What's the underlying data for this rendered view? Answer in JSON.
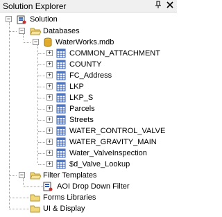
{
  "window": {
    "title": "Solution Explorer",
    "pin_glyph": "p",
    "close_glyph": "×"
  },
  "tree": {
    "solution": {
      "label": "Solution",
      "icon": "solution-icon",
      "expanded": true
    },
    "databases": {
      "label": "Databases",
      "icon": "folder-open-icon",
      "expanded": true
    },
    "database": {
      "label": "WaterWorks.mdb",
      "icon": "database-icon",
      "expanded": true
    },
    "tables": [
      {
        "label": "COMMON_ATTACHMENT",
        "icon": "table-icon"
      },
      {
        "label": "COUNTY",
        "icon": "table-icon"
      },
      {
        "label": "FC_Address",
        "icon": "table-icon"
      },
      {
        "label": "LKP",
        "icon": "table-icon"
      },
      {
        "label": "LKP_S",
        "icon": "table-icon"
      },
      {
        "label": "Parcels",
        "icon": "table-icon"
      },
      {
        "label": "Streets",
        "icon": "table-icon"
      },
      {
        "label": "WATER_CONTROL_VALVE",
        "icon": "table-icon"
      },
      {
        "label": "WATER_GRAVITY_MAIN",
        "icon": "table-icon"
      },
      {
        "label": "Water_ValveInspection",
        "icon": "table-icon"
      },
      {
        "label": "$d_Valve_Lookup",
        "icon": "table-icon"
      }
    ],
    "filter_templates": {
      "label": "Filter Templates",
      "icon": "folder-open-icon",
      "expanded": true
    },
    "filter_item": {
      "label": "AOI Drop Down Filter",
      "icon": "filter-document-icon"
    },
    "forms_libraries": {
      "label": "Forms Libraries",
      "icon": "folder-icon"
    },
    "ui_display": {
      "label": "UI & Display",
      "icon": "folder-icon"
    }
  },
  "colors": {
    "folder": "#e8c65a",
    "table_grid": "#4a78c8",
    "database": "#d9a520"
  }
}
